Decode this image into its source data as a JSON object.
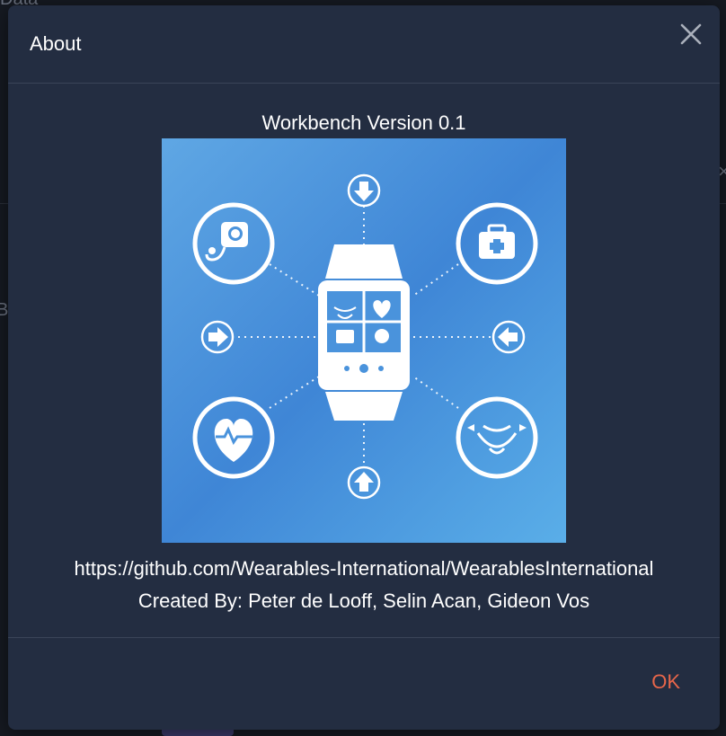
{
  "background": {
    "text_data": "Data",
    "text_bi": "Bi"
  },
  "dialog": {
    "title": "About",
    "close_icon": "close-icon",
    "version": "Workbench Version 0.1",
    "logo_icon": "smartwatch-health-icon",
    "url": "https://github.com/Wearables-International/WearablesInternational",
    "creators": "Created By: Peter de Looff, Selin Acan, Gideon Vos",
    "ok_label": "OK"
  },
  "colors": {
    "dialog_bg": "#232d41",
    "accent": "#e8664a",
    "logo_bg": "#4a93dc"
  }
}
